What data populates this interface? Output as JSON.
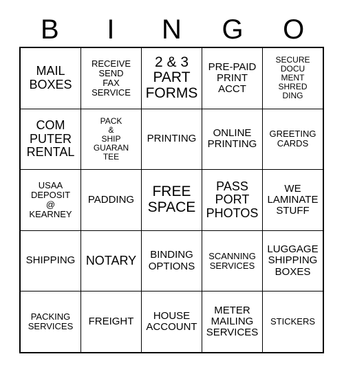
{
  "card": {
    "title": "BINGO",
    "headers": [
      "B",
      "I",
      "N",
      "G",
      "O"
    ],
    "free_space_label": "FREE\nSPACE",
    "colors": {
      "background": "#ffffff",
      "text": "#000000",
      "grid_line": "#000000"
    },
    "rows": [
      [
        {
          "label": "MAIL\nBOXES",
          "size": "fs-lg"
        },
        {
          "label": "RECEIVE\nSEND\nFAX\nSERVICE",
          "size": "fs-sm"
        },
        {
          "label": "2 & 3\nPART\nFORMS",
          "size": "fs-xl"
        },
        {
          "label": "PRE-PAID\nPRINT\nACCT",
          "size": "fs-md"
        },
        {
          "label": "SECURE\nDOCU\nMENT\nSHRED\nDING",
          "size": "fs-xs"
        }
      ],
      [
        {
          "label": "COM\nPUTER\nRENTAL",
          "size": "fs-lg"
        },
        {
          "label": "PACK\n&\nSHIP\nGUARAN\nTEE",
          "size": "fs-xs"
        },
        {
          "label": "PRINTING",
          "size": "fs-md"
        },
        {
          "label": "ONLINE\nPRINTING",
          "size": "fs-md"
        },
        {
          "label": "GREETING\nCARDS",
          "size": "fs-sm"
        }
      ],
      [
        {
          "label": "USAA\nDEPOSIT\n@\nKEARNEY",
          "size": "fs-sm"
        },
        {
          "label": "PADDING",
          "size": "fs-md"
        },
        {
          "label": "FREE\nSPACE",
          "size": "fs-xl"
        },
        {
          "label": "PASS\nPORT\nPHOTOS",
          "size": "fs-lg"
        },
        {
          "label": "WE\nLAMINATE\nSTUFF",
          "size": "fs-md"
        }
      ],
      [
        {
          "label": "SHIPPING",
          "size": "fs-md"
        },
        {
          "label": "NOTARY",
          "size": "fs-lg"
        },
        {
          "label": "BINDING\nOPTIONS",
          "size": "fs-md"
        },
        {
          "label": "SCANNING\nSERVICES",
          "size": "fs-sm"
        },
        {
          "label": "LUGGAGE\nSHIPPING\nBOXES",
          "size": "fs-md"
        }
      ],
      [
        {
          "label": "PACKING\nSERVICES",
          "size": "fs-sm"
        },
        {
          "label": "FREIGHT",
          "size": "fs-md"
        },
        {
          "label": "HOUSE\nACCOUNT",
          "size": "fs-md"
        },
        {
          "label": "METER\nMAILING\nSERVICES",
          "size": "fs-md"
        },
        {
          "label": "STICKERS",
          "size": "fs-sm"
        }
      ]
    ]
  }
}
